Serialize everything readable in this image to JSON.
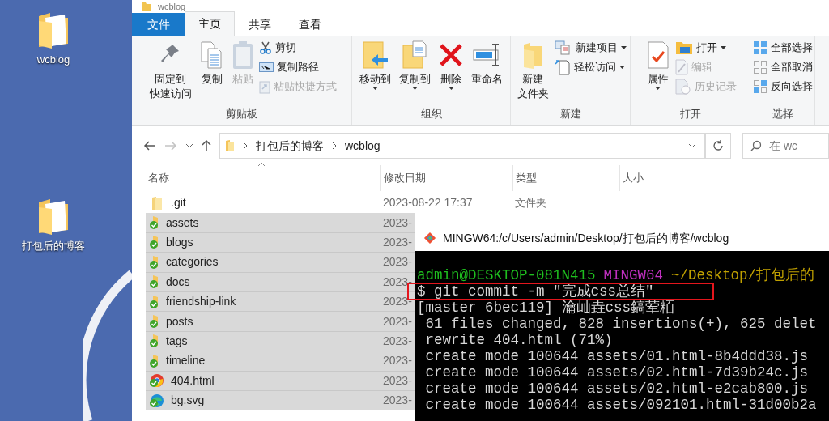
{
  "desktop": {
    "icons": [
      {
        "label": "wcblog"
      },
      {
        "label": "打包后的博客"
      }
    ]
  },
  "explorer": {
    "title": "wcblog",
    "tabs": [
      {
        "label": "文件",
        "kind": "file",
        "selected": false
      },
      {
        "label": "主页",
        "kind": "tab",
        "selected": true
      },
      {
        "label": "共享",
        "kind": "tab",
        "selected": false
      },
      {
        "label": "查看",
        "kind": "tab",
        "selected": false
      }
    ],
    "ribbon": [
      {
        "name": "剪贴板",
        "items": [
          {
            "kind": "large",
            "lines": [
              "固定到",
              "快速访问"
            ],
            "disabled": false,
            "dropdown": false
          },
          {
            "kind": "large",
            "lines": [
              "复制"
            ],
            "disabled": false,
            "dropdown": false
          },
          {
            "kind": "large",
            "lines": [
              "粘贴"
            ],
            "disabled": true,
            "dropdown": false
          },
          {
            "kind": "small",
            "label": "剪切",
            "disabled": false,
            "dropdown": false
          },
          {
            "kind": "small",
            "label": "复制路径",
            "disabled": false,
            "dropdown": false
          },
          {
            "kind": "small",
            "label": "粘贴快捷方式",
            "disabled": true,
            "dropdown": false
          }
        ]
      },
      {
        "name": "组织",
        "items": [
          {
            "kind": "large",
            "lines": [
              "移动到"
            ],
            "disabled": false,
            "dropdown": true
          },
          {
            "kind": "large",
            "lines": [
              "复制到"
            ],
            "disabled": false,
            "dropdown": true
          },
          {
            "kind": "large",
            "lines": [
              "删除"
            ],
            "disabled": false,
            "dropdown": true
          },
          {
            "kind": "large",
            "lines": [
              "重命名"
            ],
            "disabled": false,
            "dropdown": false
          }
        ]
      },
      {
        "name": "新建",
        "items": [
          {
            "kind": "large",
            "lines": [
              "新建",
              "文件夹"
            ],
            "disabled": false,
            "dropdown": false
          },
          {
            "kind": "small",
            "label": "新建项目",
            "disabled": false,
            "dropdown": true
          },
          {
            "kind": "small",
            "label": "轻松访问",
            "disabled": false,
            "dropdown": true
          }
        ]
      },
      {
        "name": "打开",
        "items": [
          {
            "kind": "large",
            "lines": [
              "属性"
            ],
            "disabled": false,
            "dropdown": true
          },
          {
            "kind": "small",
            "label": "打开",
            "disabled": false,
            "dropdown": true
          },
          {
            "kind": "small",
            "label": "编辑",
            "disabled": true,
            "dropdown": false
          },
          {
            "kind": "small",
            "label": "历史记录",
            "disabled": true,
            "dropdown": false
          }
        ]
      },
      {
        "name": "选择",
        "items": [
          {
            "kind": "small",
            "label": "全部选择",
            "disabled": false,
            "dropdown": false
          },
          {
            "kind": "small",
            "label": "全部取消",
            "disabled": false,
            "dropdown": false
          },
          {
            "kind": "small",
            "label": "反向选择",
            "disabled": false,
            "dropdown": false
          }
        ]
      }
    ],
    "nav": {
      "forward_disabled": true
    },
    "address": {
      "segments": [
        "打包后的博客",
        "wcblog"
      ]
    },
    "search": {
      "placeholder": "在 wc"
    },
    "columns": [
      "名称",
      "修改日期",
      "类型",
      "大小"
    ],
    "rows": [
      {
        "name": ".git",
        "kind": "folder",
        "date": "2023-08-22 17:37",
        "type": "文件夹",
        "selected": false
      },
      {
        "name": "assets",
        "kind": "folder-synced",
        "date": "2023-",
        "selected": true
      },
      {
        "name": "blogs",
        "kind": "folder-synced",
        "date": "2023-",
        "selected": true
      },
      {
        "name": "categories",
        "kind": "folder-synced",
        "date": "2023-",
        "selected": true
      },
      {
        "name": "docs",
        "kind": "folder-synced",
        "date": "2023-",
        "selected": true
      },
      {
        "name": "friendship-link",
        "kind": "folder-synced",
        "date": "2023-",
        "selected": true
      },
      {
        "name": "posts",
        "kind": "folder-synced",
        "date": "2023-",
        "selected": true
      },
      {
        "name": "tags",
        "kind": "folder-synced",
        "date": "2023-",
        "selected": true
      },
      {
        "name": "timeline",
        "kind": "folder-synced",
        "date": "2023-",
        "selected": true
      },
      {
        "name": "404.html",
        "kind": "browser-file",
        "date": "2023-",
        "selected": true
      },
      {
        "name": "bg.svg",
        "kind": "edge-file",
        "date": "2023-",
        "selected": true
      }
    ]
  },
  "terminal": {
    "title": "MINGW64:/c/Users/admin/Desktop/打包后的博客/wcblog",
    "lines": [
      {
        "kind": "prompt",
        "parts": [
          {
            "text": "admin@DESKTOP-081N415",
            "color": "#1fc01f"
          },
          {
            "text": "MINGW64",
            "color": "#c030c0"
          },
          {
            "text": "~/Desktop/打包后的",
            "color": "#c0a000"
          }
        ]
      },
      {
        "kind": "command",
        "text": "$ git commit -m \"完成css总结\""
      },
      {
        "kind": "output",
        "text": "[master 6bec119] 瀹屾垚css鎬荤粨"
      },
      {
        "kind": "output",
        "text": " 61 files changed, 828 insertions(+), 625 delet"
      },
      {
        "kind": "output",
        "text": " rewrite 404.html (71%)"
      },
      {
        "kind": "output",
        "text": " create mode 100644 assets/01.html-8b4ddd38.js"
      },
      {
        "kind": "output",
        "text": " create mode 100644 assets/02.html-7d39b24c.js"
      },
      {
        "kind": "output",
        "text": " create mode 100644 assets/02.html-e2cab800.js"
      },
      {
        "kind": "output",
        "text": " create mode 100644 assets/092101.html-31d00b2a"
      }
    ],
    "highlight": true
  }
}
